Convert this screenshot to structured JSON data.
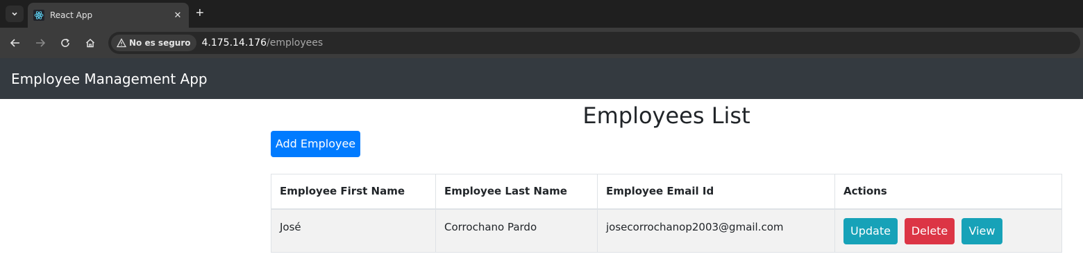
{
  "browser": {
    "tab_title": "React App",
    "security_label": "No es seguro",
    "url_host": "4.175.14.176",
    "url_path": "/employees"
  },
  "app": {
    "brand": "Employee Management App"
  },
  "main": {
    "title": "Employees List",
    "add_button": "Add Employee",
    "table": {
      "headers": [
        "Employee First Name",
        "Employee Last Name",
        "Employee Email Id",
        "Actions"
      ],
      "rows": [
        {
          "first_name": "José",
          "last_name": "Corrochano Pardo",
          "email": "josecorrochanop2003@gmail.com",
          "actions": [
            "Update",
            "Delete",
            "View"
          ]
        }
      ]
    }
  }
}
